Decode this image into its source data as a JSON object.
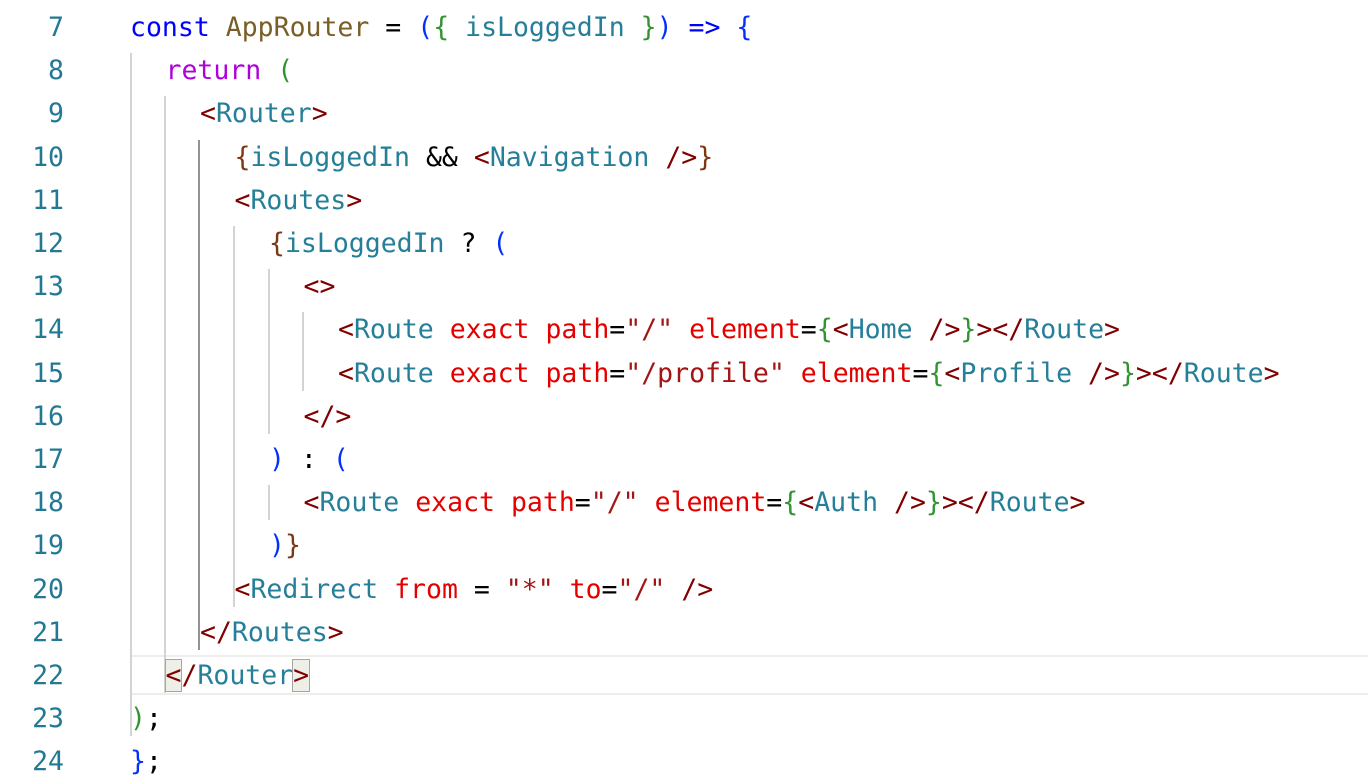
{
  "editor": {
    "language": "javascript-react",
    "current_line": 22,
    "lines": [
      {
        "number": "7",
        "tokens": [
          {
            "text": "const",
            "type": "keyword"
          },
          {
            "text": " ",
            "type": "plain"
          },
          {
            "text": "AppRouter",
            "type": "function"
          },
          {
            "text": " = ",
            "type": "op"
          },
          {
            "text": "(",
            "type": "b1"
          },
          {
            "text": "{",
            "type": "b2"
          },
          {
            "text": " isLoggedIn ",
            "type": "param"
          },
          {
            "text": "}",
            "type": "b2"
          },
          {
            "text": ")",
            "type": "b1"
          },
          {
            "text": " ",
            "type": "plain"
          },
          {
            "text": "=>",
            "type": "keyword"
          },
          {
            "text": " ",
            "type": "plain"
          },
          {
            "text": "{",
            "type": "b1"
          }
        ]
      },
      {
        "number": "8",
        "tokens": [
          {
            "text": "return",
            "type": "control"
          },
          {
            "text": " ",
            "type": "plain"
          },
          {
            "text": "(",
            "type": "b2"
          }
        ]
      },
      {
        "number": "9",
        "tokens": [
          {
            "text": "<",
            "type": "tagpunct"
          },
          {
            "text": "Router",
            "type": "component"
          },
          {
            "text": ">",
            "type": "tagpunct"
          }
        ]
      },
      {
        "number": "10",
        "tokens": [
          {
            "text": "{",
            "type": "b3"
          },
          {
            "text": "isLoggedIn",
            "type": "param"
          },
          {
            "text": " && ",
            "type": "op"
          },
          {
            "text": "<",
            "type": "tagpunct"
          },
          {
            "text": "Navigation",
            "type": "component"
          },
          {
            "text": " />",
            "type": "tagpunct"
          },
          {
            "text": "}",
            "type": "b3"
          }
        ]
      },
      {
        "number": "11",
        "tokens": [
          {
            "text": "<",
            "type": "tagpunct"
          },
          {
            "text": "Routes",
            "type": "component"
          },
          {
            "text": ">",
            "type": "tagpunct"
          }
        ]
      },
      {
        "number": "12",
        "tokens": [
          {
            "text": "{",
            "type": "b3"
          },
          {
            "text": "isLoggedIn",
            "type": "param"
          },
          {
            "text": " ? ",
            "type": "op"
          },
          {
            "text": "(",
            "type": "b1"
          }
        ]
      },
      {
        "number": "13",
        "tokens": [
          {
            "text": "<>",
            "type": "tagpunct"
          }
        ]
      },
      {
        "number": "14",
        "tokens": [
          {
            "text": "<",
            "type": "tagpunct"
          },
          {
            "text": "Route",
            "type": "component"
          },
          {
            "text": " ",
            "type": "plain"
          },
          {
            "text": "exact",
            "type": "attr"
          },
          {
            "text": " ",
            "type": "plain"
          },
          {
            "text": "path",
            "type": "attr"
          },
          {
            "text": "=",
            "type": "op"
          },
          {
            "text": "\"/\"",
            "type": "string"
          },
          {
            "text": " ",
            "type": "plain"
          },
          {
            "text": "element",
            "type": "attr"
          },
          {
            "text": "=",
            "type": "op"
          },
          {
            "text": "{",
            "type": "b2"
          },
          {
            "text": "<",
            "type": "tagpunct"
          },
          {
            "text": "Home",
            "type": "component"
          },
          {
            "text": " />",
            "type": "tagpunct"
          },
          {
            "text": "}",
            "type": "b2"
          },
          {
            "text": "></",
            "type": "tagpunct"
          },
          {
            "text": "Route",
            "type": "component"
          },
          {
            "text": ">",
            "type": "tagpunct"
          }
        ]
      },
      {
        "number": "15",
        "tokens": [
          {
            "text": "<",
            "type": "tagpunct"
          },
          {
            "text": "Route",
            "type": "component"
          },
          {
            "text": " ",
            "type": "plain"
          },
          {
            "text": "exact",
            "type": "attr"
          },
          {
            "text": " ",
            "type": "plain"
          },
          {
            "text": "path",
            "type": "attr"
          },
          {
            "text": "=",
            "type": "op"
          },
          {
            "text": "\"/profile\"",
            "type": "string"
          },
          {
            "text": " ",
            "type": "plain"
          },
          {
            "text": "element",
            "type": "attr"
          },
          {
            "text": "=",
            "type": "op"
          },
          {
            "text": "{",
            "type": "b2"
          },
          {
            "text": "<",
            "type": "tagpunct"
          },
          {
            "text": "Profile",
            "type": "component"
          },
          {
            "text": " />",
            "type": "tagpunct"
          },
          {
            "text": "}",
            "type": "b2"
          },
          {
            "text": "></",
            "type": "tagpunct"
          },
          {
            "text": "Route",
            "type": "component"
          },
          {
            "text": ">",
            "type": "tagpunct"
          }
        ]
      },
      {
        "number": "16",
        "tokens": [
          {
            "text": "</>",
            "type": "tagpunct"
          }
        ]
      },
      {
        "number": "17",
        "tokens": [
          {
            "text": ")",
            "type": "b1"
          },
          {
            "text": " : ",
            "type": "op"
          },
          {
            "text": "(",
            "type": "b1"
          }
        ]
      },
      {
        "number": "18",
        "tokens": [
          {
            "text": "<",
            "type": "tagpunct"
          },
          {
            "text": "Route",
            "type": "component"
          },
          {
            "text": " ",
            "type": "plain"
          },
          {
            "text": "exact",
            "type": "attr"
          },
          {
            "text": " ",
            "type": "plain"
          },
          {
            "text": "path",
            "type": "attr"
          },
          {
            "text": "=",
            "type": "op"
          },
          {
            "text": "\"/\"",
            "type": "string"
          },
          {
            "text": " ",
            "type": "plain"
          },
          {
            "text": "element",
            "type": "attr"
          },
          {
            "text": "=",
            "type": "op"
          },
          {
            "text": "{",
            "type": "b2"
          },
          {
            "text": "<",
            "type": "tagpunct"
          },
          {
            "text": "Auth",
            "type": "component"
          },
          {
            "text": " />",
            "type": "tagpunct"
          },
          {
            "text": "}",
            "type": "b2"
          },
          {
            "text": "></",
            "type": "tagpunct"
          },
          {
            "text": "Route",
            "type": "component"
          },
          {
            "text": ">",
            "type": "tagpunct"
          }
        ]
      },
      {
        "number": "19",
        "tokens": [
          {
            "text": ")",
            "type": "b1"
          },
          {
            "text": "}",
            "type": "b3"
          }
        ]
      },
      {
        "number": "20",
        "tokens": [
          {
            "text": "<",
            "type": "tagpunct"
          },
          {
            "text": "Redirect",
            "type": "component"
          },
          {
            "text": " ",
            "type": "plain"
          },
          {
            "text": "from",
            "type": "attr"
          },
          {
            "text": " = ",
            "type": "op"
          },
          {
            "text": "\"*\"",
            "type": "string"
          },
          {
            "text": " ",
            "type": "plain"
          },
          {
            "text": "to",
            "type": "attr"
          },
          {
            "text": "=",
            "type": "op"
          },
          {
            "text": "\"/\"",
            "type": "string"
          },
          {
            "text": " />",
            "type": "tagpunct"
          }
        ]
      },
      {
        "number": "21",
        "tokens": [
          {
            "text": "</",
            "type": "tagpunct"
          },
          {
            "text": "Routes",
            "type": "component"
          },
          {
            "text": ">",
            "type": "tagpunct"
          }
        ]
      },
      {
        "number": "22",
        "tokens": [
          {
            "text": "<",
            "type": "tagpunct",
            "bracket_match": true
          },
          {
            "text": "/",
            "type": "tagpunct"
          },
          {
            "text": "Router",
            "type": "component"
          },
          {
            "text": ">",
            "type": "tagpunct",
            "bracket_match": true
          }
        ]
      },
      {
        "number": "23",
        "tokens": [
          {
            "text": ")",
            "type": "b2"
          },
          {
            "text": ";",
            "type": "op"
          }
        ]
      },
      {
        "number": "24",
        "tokens": [
          {
            "text": "}",
            "type": "b1"
          },
          {
            "text": ";",
            "type": "op"
          }
        ]
      }
    ]
  }
}
